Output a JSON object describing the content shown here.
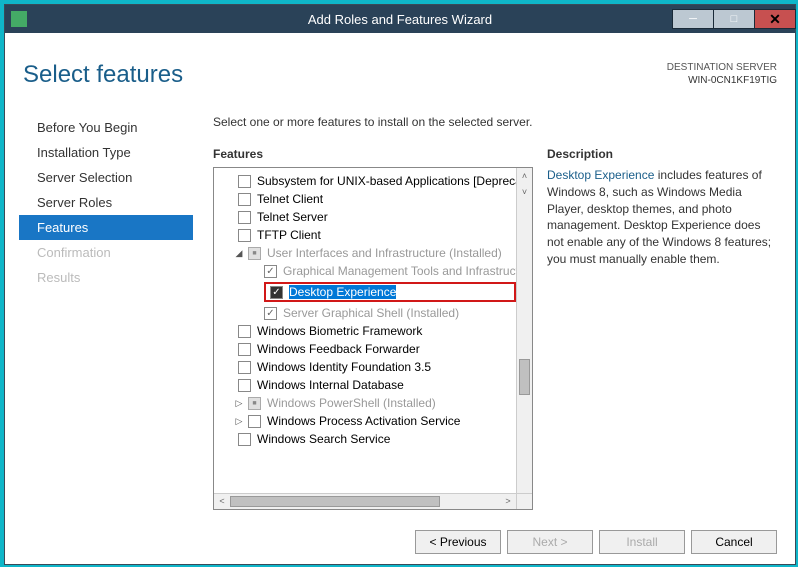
{
  "title": "Add Roles and Features Wizard",
  "dest_label": "DESTINATION SERVER",
  "dest_server": "WIN-0CN1KF19TIG",
  "page_title": "Select features",
  "instruction": "Select one or more features to install on the selected server.",
  "labels": {
    "features": "Features",
    "description": "Description"
  },
  "nav": [
    {
      "label": "Before You Begin"
    },
    {
      "label": "Installation Type"
    },
    {
      "label": "Server Selection"
    },
    {
      "label": "Server Roles"
    },
    {
      "label": "Features"
    },
    {
      "label": "Confirmation"
    },
    {
      "label": "Results"
    }
  ],
  "features": [
    {
      "label": "Subsystem for UNIX-based Applications [Deprecated]"
    },
    {
      "label": "Telnet Client"
    },
    {
      "label": "Telnet Server"
    },
    {
      "label": "TFTP Client"
    },
    {
      "label": "User Interfaces and Infrastructure (Installed)"
    },
    {
      "label": "Graphical Management Tools and Infrastructure"
    },
    {
      "label": "Desktop Experience"
    },
    {
      "label": "Server Graphical Shell (Installed)"
    },
    {
      "label": "Windows Biometric Framework"
    },
    {
      "label": "Windows Feedback Forwarder"
    },
    {
      "label": "Windows Identity Foundation 3.5"
    },
    {
      "label": "Windows Internal Database"
    },
    {
      "label": "Windows PowerShell (Installed)"
    },
    {
      "label": "Windows Process Activation Service"
    },
    {
      "label": "Windows Search Service"
    }
  ],
  "description": {
    "link": "Desktop Experience",
    "rest": " includes features of Windows 8, such as Windows Media Player, desktop themes, and photo management. Desktop Experience does not enable any of the Windows 8 features; you must manually enable them."
  },
  "buttons": {
    "previous": "< Previous",
    "next": "Next >",
    "install": "Install",
    "cancel": "Cancel"
  }
}
